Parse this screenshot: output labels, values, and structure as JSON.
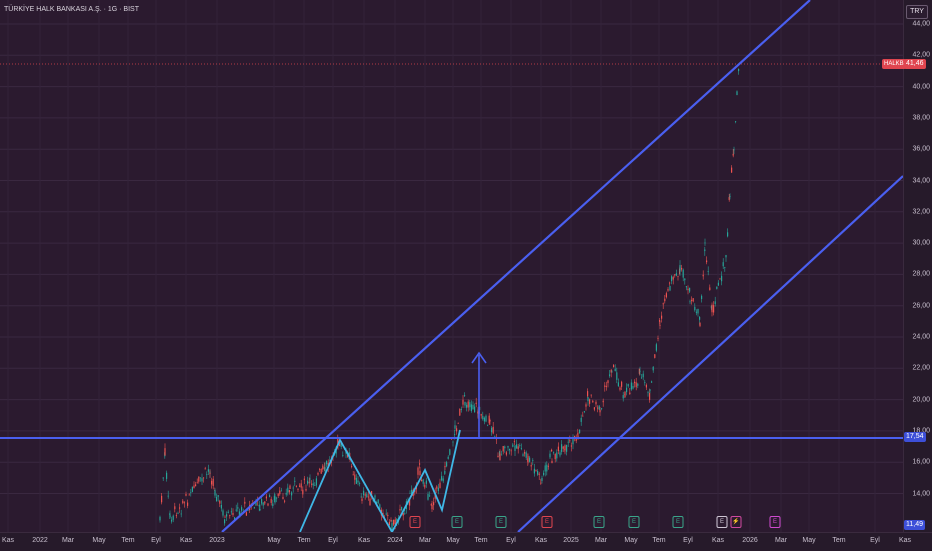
{
  "header": {
    "title": "TÜRKİYE HALK BANKASI A.Ş. · 1G · BIST"
  },
  "currency_button": "TRY",
  "price_axis": {
    "labels": [
      "44,00",
      "42,00",
      "40,00",
      "38,00",
      "36,00",
      "34,00",
      "32,00",
      "30,00",
      "28,00",
      "26,00",
      "24,00",
      "22,00",
      "20,00",
      "18,00",
      "16,00",
      "14,00"
    ]
  },
  "time_axis": {
    "labels": [
      "Kas",
      "2022",
      "Mar",
      "May",
      "Tem",
      "Eyl",
      "Kas",
      "2023",
      "May",
      "Tem",
      "Eyl",
      "Kas",
      "2024",
      "Mar",
      "May",
      "Tem",
      "Eyl",
      "Kas",
      "2025",
      "Mar",
      "May",
      "Tem",
      "Eyl",
      "Kas",
      "2026",
      "Mar",
      "May",
      "Tem",
      "Eyl",
      "Kas"
    ]
  },
  "badges": {
    "symbol": "HALKB",
    "last_price": "41,46",
    "support_price": "17,54",
    "low_price": "11,49"
  },
  "events": [
    {
      "label": "E",
      "color": "#e0454f"
    },
    {
      "label": "E",
      "color": "#3aa58a"
    },
    {
      "label": "E",
      "color": "#3aa58a"
    },
    {
      "label": "E",
      "color": "#e0454f"
    },
    {
      "label": "E",
      "color": "#3aa58a"
    },
    {
      "label": "E",
      "color": "#3aa58a"
    },
    {
      "label": "E",
      "color": "#3aa58a"
    },
    {
      "label": "E",
      "color": "#cfc6d4"
    },
    {
      "label": "⚡",
      "color": "#d04aa0"
    },
    {
      "label": "E",
      "color": "#d04ad0"
    }
  ],
  "colors": {
    "up": "#26a69a",
    "down": "#ef5350",
    "trend": "#4a5ff0",
    "pattern": "#3fb7e6",
    "last_line": "#e0454f"
  }
}
